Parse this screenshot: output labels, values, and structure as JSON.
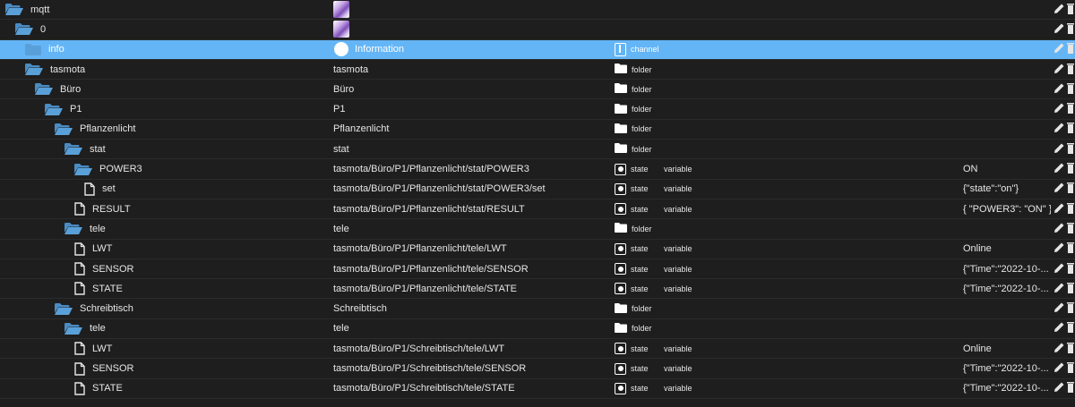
{
  "colors": {
    "background": "#1e1e1e",
    "selected_row": "#64b5f6",
    "folder": "#5aa0d8",
    "text": "#e6e6e6"
  },
  "rows": [
    {
      "level": 0,
      "icon": "folder-open-icon",
      "name": "mqtt",
      "title": "",
      "title_icon": "image-thumbnail",
      "type": "",
      "role": "",
      "value": ""
    },
    {
      "level": 1,
      "icon": "folder-open-icon",
      "name": "0",
      "title": "",
      "title_icon": "image-thumbnail",
      "type": "",
      "role": "",
      "value": ""
    },
    {
      "level": 2,
      "icon": "folder-icon",
      "name": "info",
      "title": "Information",
      "title_icon": "info-icon",
      "type": "channel",
      "type_icon": "channel-icon",
      "role": "",
      "value": "",
      "selected": true
    },
    {
      "level": 2,
      "icon": "folder-open-icon",
      "name": "tasmota",
      "title": "tasmota",
      "type": "folder",
      "type_icon": "folder-white-icon",
      "role": "",
      "value": ""
    },
    {
      "level": 3,
      "icon": "folder-open-icon",
      "name": "Büro",
      "title": "Büro",
      "type": "folder",
      "type_icon": "folder-white-icon",
      "role": "",
      "value": ""
    },
    {
      "level": 4,
      "icon": "folder-open-icon",
      "name": "P1",
      "title": "P1",
      "type": "folder",
      "type_icon": "folder-white-icon",
      "role": "",
      "value": ""
    },
    {
      "level": 5,
      "icon": "folder-open-icon",
      "name": "Pflanzenlicht",
      "title": "Pflanzenlicht",
      "type": "folder",
      "type_icon": "folder-white-icon",
      "role": "",
      "value": ""
    },
    {
      "level": 6,
      "icon": "folder-open-icon",
      "name": "stat",
      "title": "stat",
      "type": "folder",
      "type_icon": "folder-white-icon",
      "role": "",
      "value": ""
    },
    {
      "level": 7,
      "icon": "folder-open-icon",
      "name": "POWER3",
      "title": "tasmota/Büro/P1/Pflanzenlicht/stat/POWER3",
      "type": "state",
      "type_icon": "state-icon",
      "role": "variable",
      "value": "ON"
    },
    {
      "level": 8,
      "icon": "file-icon",
      "name": "set",
      "title": "tasmota/Büro/P1/Pflanzenlicht/stat/POWER3/set",
      "type": "state",
      "type_icon": "state-icon",
      "role": "variable",
      "value": "{\"state\":\"on\"}"
    },
    {
      "level": 7,
      "icon": "file-icon",
      "name": "RESULT",
      "title": "tasmota/Büro/P1/Pflanzenlicht/stat/RESULT",
      "type": "state",
      "type_icon": "state-icon",
      "role": "variable",
      "value": "{ \"POWER3\": \"ON\" }"
    },
    {
      "level": 6,
      "icon": "folder-open-icon",
      "name": "tele",
      "title": "tele",
      "type": "folder",
      "type_icon": "folder-white-icon",
      "role": "",
      "value": ""
    },
    {
      "level": 7,
      "icon": "file-icon",
      "name": "LWT",
      "title": "tasmota/Büro/P1/Pflanzenlicht/tele/LWT",
      "type": "state",
      "type_icon": "state-icon",
      "role": "variable",
      "value": "Online"
    },
    {
      "level": 7,
      "icon": "file-icon",
      "name": "SENSOR",
      "title": "tasmota/Büro/P1/Pflanzenlicht/tele/SENSOR",
      "type": "state",
      "type_icon": "state-icon",
      "role": "variable",
      "value": "{\"Time\":\"2022-10-..."
    },
    {
      "level": 7,
      "icon": "file-icon",
      "name": "STATE",
      "title": "tasmota/Büro/P1/Pflanzenlicht/tele/STATE",
      "type": "state",
      "type_icon": "state-icon",
      "role": "variable",
      "value": "{\"Time\":\"2022-10-..."
    },
    {
      "level": 5,
      "icon": "folder-open-icon",
      "name": "Schreibtisch",
      "title": "Schreibtisch",
      "type": "folder",
      "type_icon": "folder-white-icon",
      "role": "",
      "value": ""
    },
    {
      "level": 6,
      "icon": "folder-open-icon",
      "name": "tele",
      "title": "tele",
      "type": "folder",
      "type_icon": "folder-white-icon",
      "role": "",
      "value": ""
    },
    {
      "level": 7,
      "icon": "file-icon",
      "name": "LWT",
      "title": "tasmota/Büro/P1/Schreibtisch/tele/LWT",
      "type": "state",
      "type_icon": "state-icon",
      "role": "variable",
      "value": "Online"
    },
    {
      "level": 7,
      "icon": "file-icon",
      "name": "SENSOR",
      "title": "tasmota/Büro/P1/Schreibtisch/tele/SENSOR",
      "type": "state",
      "type_icon": "state-icon",
      "role": "variable",
      "value": "{\"Time\":\"2022-10-..."
    },
    {
      "level": 7,
      "icon": "file-icon",
      "name": "STATE",
      "title": "tasmota/Büro/P1/Schreibtisch/tele/STATE",
      "type": "state",
      "type_icon": "state-icon",
      "role": "variable",
      "value": "{\"Time\":\"2022-10-..."
    }
  ]
}
